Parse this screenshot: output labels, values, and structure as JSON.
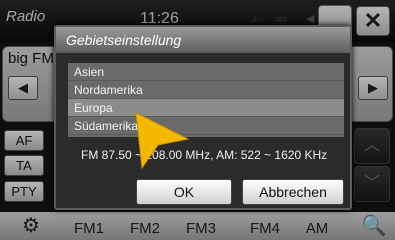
{
  "app": {
    "title": "Radio",
    "clock": "11:26",
    "station": "big FM",
    "close_glyph": "✕",
    "status_glyphs": "♪ ▭ ◀"
  },
  "nav": {
    "prev_glyph": "◀",
    "next_glyph": "▶"
  },
  "side_buttons": {
    "af": "AF",
    "ta": "TA",
    "pty": "PTY"
  },
  "scroll": {
    "up_glyph": "︿",
    "down_glyph": "﹀"
  },
  "bottom_bar": {
    "settings_icon": "⚙",
    "bands": [
      "FM1",
      "FM2",
      "FM3",
      "FM4",
      "AM"
    ],
    "search_icon": "🔍"
  },
  "dialog": {
    "title": "Gebietseinstellung",
    "regions": [
      "Asien",
      "Nordamerika",
      "Europa",
      "Südamerika"
    ],
    "selected_region": "Europa",
    "range_info": "FM 87.50 ~ 108.00 MHz, AM: 522 ~ 1620 KHz",
    "ok_label": "OK",
    "cancel_label": "Abbrechen"
  },
  "colors": {
    "pointer": "#f5b800",
    "dialog_bg": "#2b2b2b",
    "list_bg": "#6a6a6a"
  }
}
